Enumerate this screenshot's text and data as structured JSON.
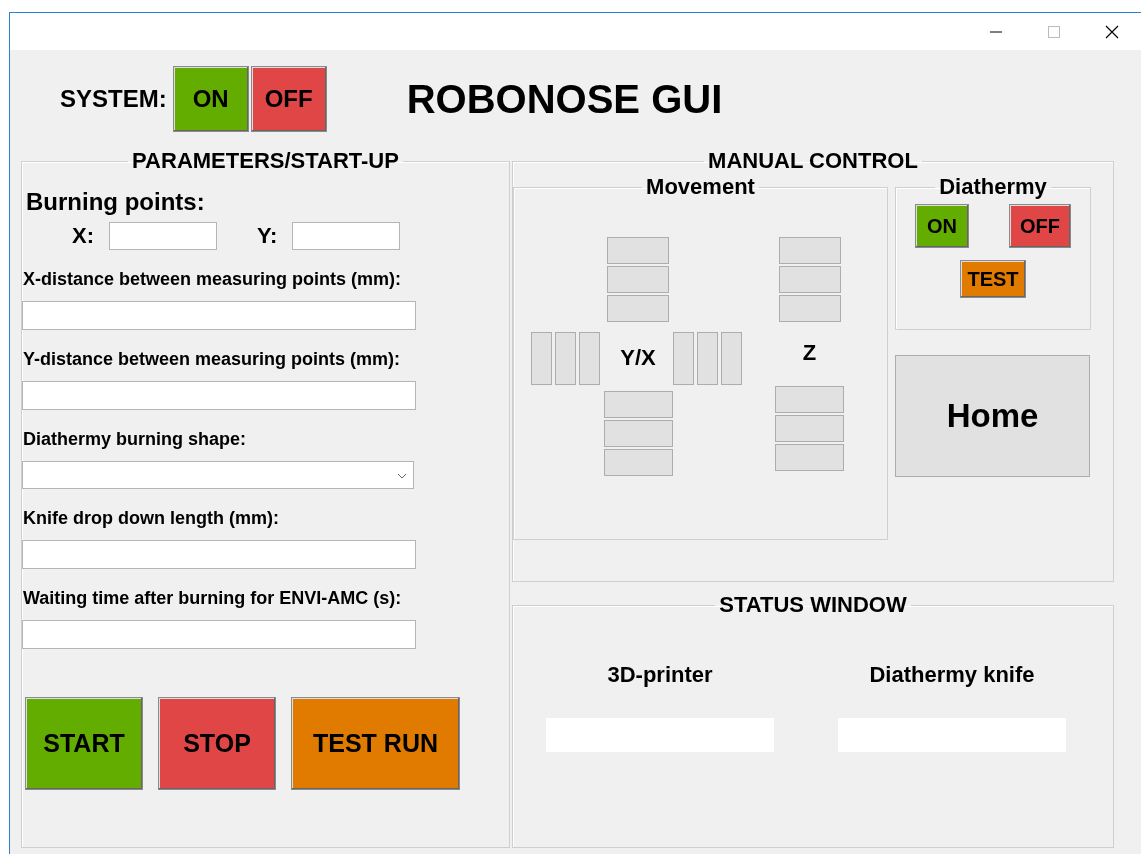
{
  "system": {
    "label": "SYSTEM:",
    "buttons": [
      {
        "label": "ON",
        "kind": "on"
      },
      {
        "label": "OFF",
        "kind": "off"
      }
    ]
  },
  "title": "ROBONOSE GUI",
  "parameters": {
    "title": "PARAMETERS/START-UP",
    "burning_points": {
      "label": "Burning points:",
      "fields": [
        {
          "label": "X:"
        },
        {
          "label": "Y:"
        }
      ]
    },
    "fields": [
      {
        "label": "X-distance between measuring points (mm):",
        "kind": "text"
      },
      {
        "label": "Y-distance between measuring points (mm):",
        "kind": "text"
      },
      {
        "label": "Diathermy burning shape:",
        "kind": "dropdown"
      },
      {
        "label": "Knife drop down length (mm):",
        "kind": "text"
      },
      {
        "label": "Waiting time after burning for ENVI-AMC (s):",
        "kind": "text"
      }
    ],
    "buttons": [
      {
        "label": "START",
        "kind": "on"
      },
      {
        "label": "STOP",
        "kind": "off"
      },
      {
        "label": "TEST RUN",
        "kind": "test"
      }
    ]
  },
  "manual_control": {
    "title": "MANUAL CONTROL",
    "movement": {
      "title": "Movement",
      "axes": [
        {
          "label": "Y/X",
          "kind": "planar"
        },
        {
          "label": "Z",
          "kind": "vertical"
        }
      ]
    },
    "diathermy": {
      "title": "Diathermy",
      "buttons": [
        {
          "label": "ON",
          "kind": "on"
        },
        {
          "label": "OFF",
          "kind": "off"
        },
        {
          "label": "TEST",
          "kind": "test"
        }
      ]
    },
    "home": "Home"
  },
  "status_window": {
    "title": "STATUS WINDOW",
    "items": [
      {
        "label": "3D-printer"
      },
      {
        "label": "Diathermy knife"
      }
    ]
  }
}
